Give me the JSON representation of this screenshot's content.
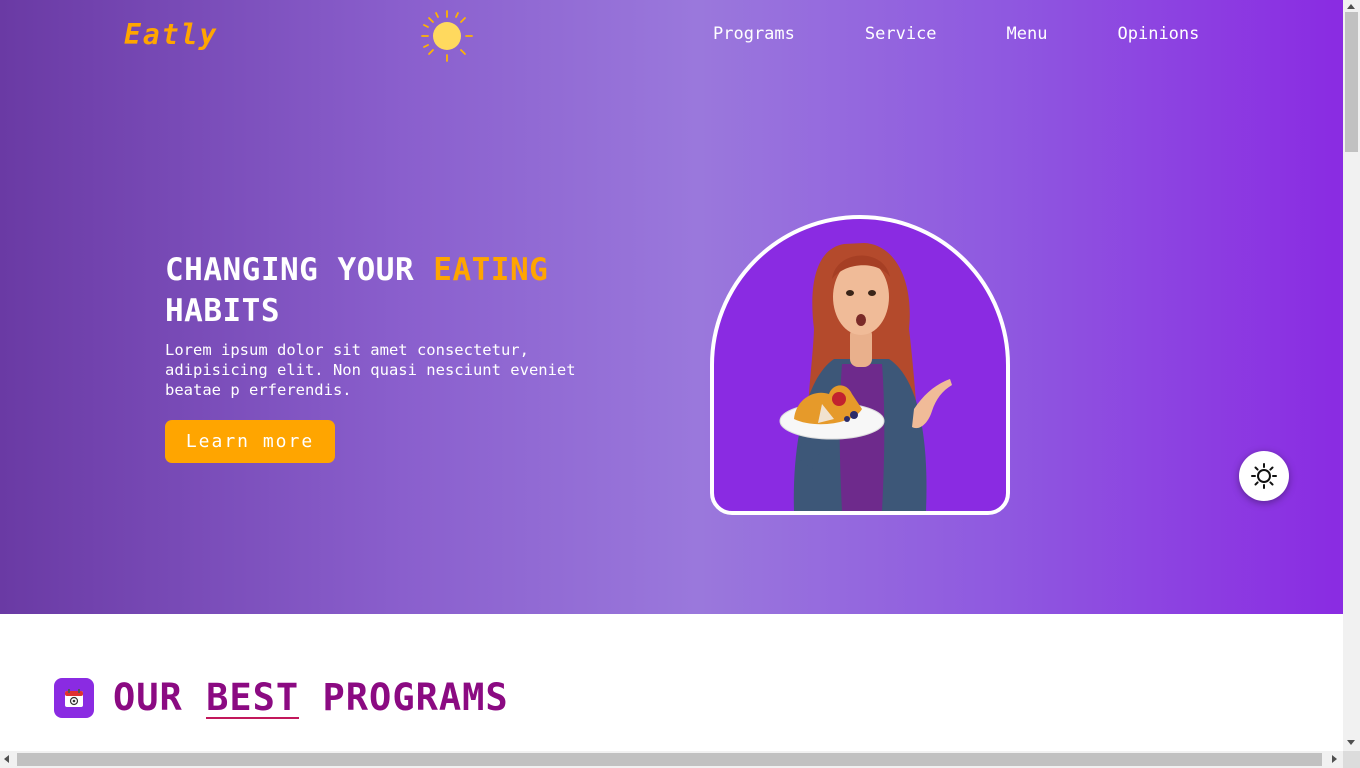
{
  "brand": {
    "logo": "Eatly"
  },
  "nav": {
    "items": [
      {
        "label": "Programs"
      },
      {
        "label": "Service"
      },
      {
        "label": "Menu"
      },
      {
        "label": "Opinions"
      }
    ]
  },
  "hero": {
    "title_part1": "CHANGING YOUR ",
    "title_accent": "EATING",
    "title_part2": "HABITS",
    "description": "Lorem ipsum dolor sit amet consectetur, adipisicing elit. Non quasi nesciunt eveniet beatae p erferendis.",
    "cta_label": "Learn more"
  },
  "section": {
    "title_word1": "OUR",
    "title_word2": "BEST",
    "title_word3": "PROGRAMS"
  },
  "colors": {
    "accent": "#ffa500",
    "purple": "#8a2be2",
    "section_title": "#8b0a82"
  },
  "icons": {
    "logo_sun": "sun-icon",
    "theme_toggle": "sun-outline-icon",
    "section": "calendar-icon"
  }
}
